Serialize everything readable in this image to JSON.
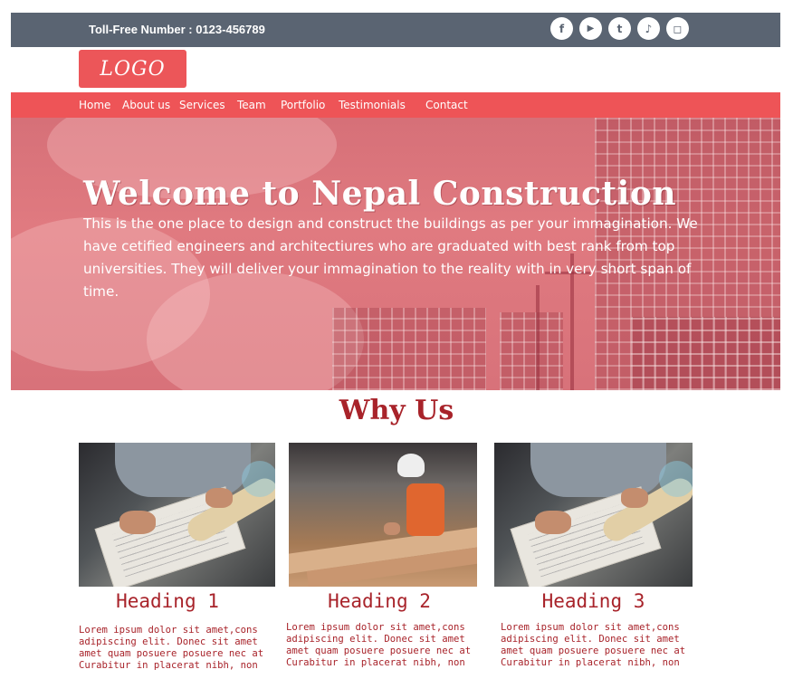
{
  "topbar": {
    "toll_free": "Toll-Free Number : 0123-456789",
    "social": [
      {
        "icon": "facebook-icon",
        "glyph": "f"
      },
      {
        "icon": "youtube-icon",
        "glyph": "▶"
      },
      {
        "icon": "twitter-icon",
        "glyph": "t"
      },
      {
        "icon": "tiktok-icon",
        "glyph": "♪"
      },
      {
        "icon": "instagram-icon",
        "glyph": "◻"
      }
    ]
  },
  "logo": {
    "text": "LOGO"
  },
  "nav": {
    "items": [
      "Home",
      "About us",
      "Services",
      "Team",
      "Portfolio",
      "Testimonials",
      "Contact"
    ]
  },
  "hero": {
    "title": "Welcome to Nepal Construction",
    "text": "This is the one place to design and construct the buildings as per your immagination. We have cetified engineers and architectiures who are graduated with best rank from top universities. They will deliver your immagination to the reality with in very short span of time."
  },
  "why": {
    "title": "Why Us",
    "cards": [
      {
        "heading": "Heading 1",
        "text": "Lorem ipsum dolor sit amet,cons adipiscing elit. Donec sit amet amet quam posuere posuere nec at Curabitur in placerat nibh, non"
      },
      {
        "heading": "Heading 2",
        "text": "Lorem ipsum dolor sit amet,cons adipiscing elit. Donec sit amet amet quam posuere posuere nec at Curabitur in placerat nibh, non"
      },
      {
        "heading": "Heading 3",
        "text": "Lorem ipsum dolor sit amet,cons adipiscing elit. Donec sit amet amet quam posuere posuere nec at Curabitur in placerat nibh, non"
      }
    ]
  },
  "colors": {
    "topbar_bg": "#5a6472",
    "accent_red": "#ee5457",
    "heading_red": "#a8232a"
  }
}
